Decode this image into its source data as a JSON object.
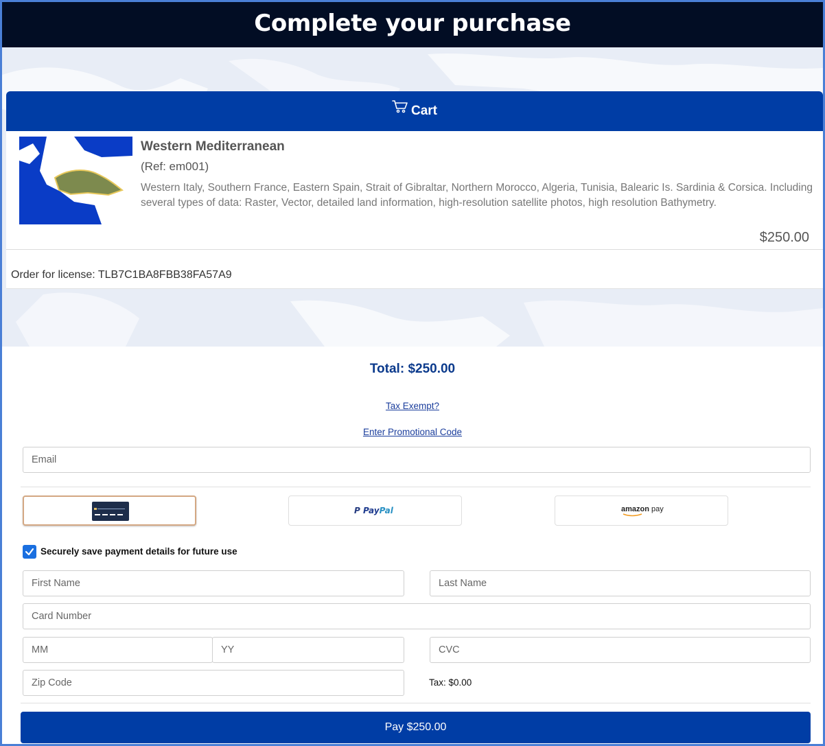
{
  "header": {
    "title": "Complete your purchase"
  },
  "cart": {
    "header_label": "Cart",
    "item": {
      "title": "Western Mediterranean",
      "ref": "(Ref: em001)",
      "description": "Western Italy, Southern France, Eastern Spain, Strait of Gibraltar, Northern Morocco, Algeria, Tunisia, Balearic Is. Sardinia & Corsica. Including several types of data: Raster, Vector, detailed land information, high-resolution satellite photos, high resolution Bathymetry.",
      "price": "$250.00"
    },
    "license_text": "Order for license: TLB7C1BA8FBB38FA57A9"
  },
  "checkout": {
    "total": "Total: $250.00",
    "tax_exempt_link": "Tax Exempt?",
    "promo_link": "Enter Promotional Code",
    "email_placeholder": "Email",
    "payment_methods": [
      {
        "name": "card",
        "selected": true
      },
      {
        "name": "PayPal",
        "selected": false
      },
      {
        "name": "amazon pay",
        "selected": false
      }
    ],
    "save_details_label": "Securely save payment details for future use",
    "save_details_checked": true,
    "fields": {
      "first_name": "First Name",
      "last_name": "Last Name",
      "card_number": "Card Number",
      "mm": "MM",
      "yy": "YY",
      "cvc": "CVC",
      "zip": "Zip Code"
    },
    "tax": "Tax: $0.00",
    "pay_button": "Pay $250.00"
  },
  "colors": {
    "topbar": "#020d24",
    "primary": "#003da5",
    "link": "#1a3d9c",
    "checkbox": "#1a6fe0"
  }
}
